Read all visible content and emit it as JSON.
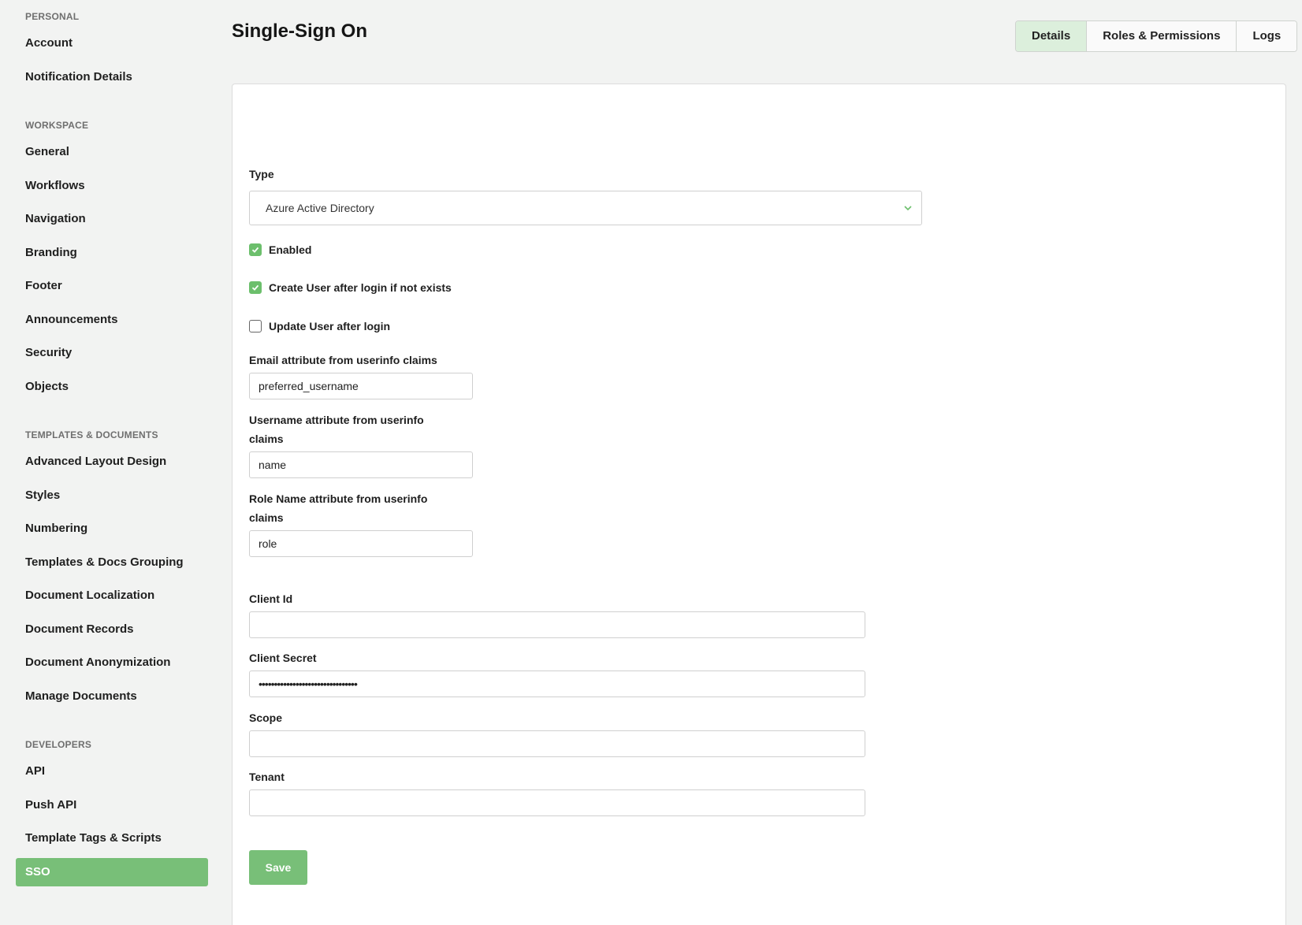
{
  "sidebar": {
    "sections": [
      {
        "title": "PERSONAL",
        "items": [
          "Account",
          "Notification Details"
        ]
      },
      {
        "title": "WORKSPACE",
        "items": [
          "General",
          "Workflows",
          "Navigation",
          "Branding",
          "Footer",
          "Announcements",
          "Security",
          "Objects"
        ]
      },
      {
        "title": "TEMPLATES & DOCUMENTS",
        "items": [
          "Advanced Layout Design",
          "Styles",
          "Numbering",
          "Templates & Docs Grouping",
          "Document Localization",
          "Document Records",
          "Document Anonymization",
          "Manage Documents"
        ]
      },
      {
        "title": "DEVELOPERS",
        "items": [
          "API",
          "Push API",
          "Template Tags & Scripts",
          "SSO"
        ]
      }
    ],
    "active_item": "SSO"
  },
  "header": {
    "title": "Single-Sign On",
    "tabs": [
      {
        "label": "Details",
        "active": true
      },
      {
        "label": "Roles & Permissions",
        "active": false
      },
      {
        "label": "Logs",
        "active": false
      }
    ]
  },
  "form": {
    "type_label": "Type",
    "type_value": "Azure Active Directory",
    "enabled": {
      "label": "Enabled",
      "checked": true
    },
    "create_user": {
      "label": "Create User after login if not exists",
      "checked": true
    },
    "update_user": {
      "label": "Update User after login",
      "checked": false
    },
    "email_attr": {
      "label": "Email attribute from userinfo claims",
      "value": "preferred_username"
    },
    "username_attr": {
      "label": "Username attribute from userinfo claims",
      "value": "name"
    },
    "role_attr": {
      "label": "Role Name attribute from userinfo claims",
      "value": "role"
    },
    "client_id": {
      "label": "Client Id",
      "value": ""
    },
    "client_secret": {
      "label": "Client Secret",
      "value": "••••••••••••••••••••••••••••••••"
    },
    "scope": {
      "label": "Scope",
      "value": ""
    },
    "tenant": {
      "label": "Tenant",
      "value": ""
    },
    "save_label": "Save"
  },
  "colors": {
    "accent": "#78bf78",
    "checkbox_checked": "#6cbf6c",
    "active_tab_bg": "#dcefdc",
    "page_bg": "#f2f3f2"
  },
  "icons": {
    "select_chevron": "chevron-down-icon",
    "checkbox_check": "check-icon"
  }
}
